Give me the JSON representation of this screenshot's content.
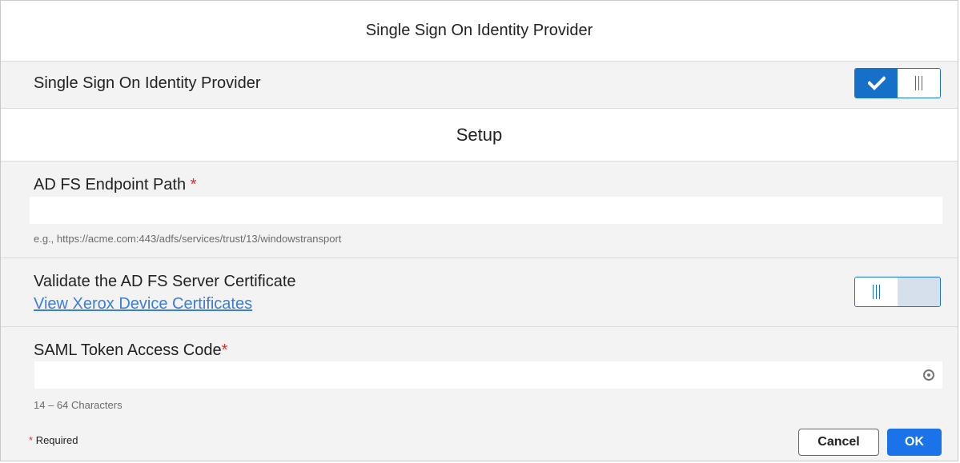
{
  "dialog": {
    "title": "Single Sign On Identity Provider"
  },
  "enable_row": {
    "label": "Single Sign On Identity Provider",
    "enabled": true
  },
  "setup": {
    "title": "Setup"
  },
  "endpoint": {
    "label": "AD FS Endpoint Path",
    "required_mark": "*",
    "value": "",
    "hint": "e.g., https://acme.com:443/adfs/services/trust/13/windowstransport"
  },
  "validate_cert": {
    "label": "Validate the AD FS Server Certificate",
    "link": "View Xerox Device Certificates",
    "enabled": false
  },
  "saml": {
    "label": "SAML Token Access Code",
    "required_mark": "*",
    "value": "",
    "hint": "14 – 64 Characters",
    "reveal_icon": "eye-icon"
  },
  "footer": {
    "required_mark": "*",
    "required_text": "Required",
    "cancel_label": "Cancel",
    "ok_label": "OK"
  },
  "colors": {
    "accent": "#1670c8",
    "required": "#d0342c",
    "link": "#3b7ddb",
    "ok_button": "#1a73e8"
  }
}
